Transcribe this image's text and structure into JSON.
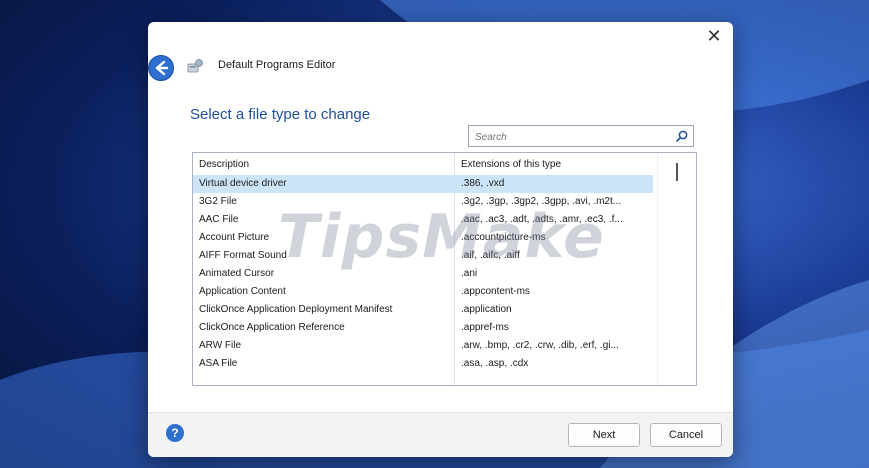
{
  "window": {
    "title": "Default Programs Editor",
    "close_glyph": "✕"
  },
  "heading": "Select a file type to change",
  "search": {
    "placeholder": "Search"
  },
  "list": {
    "columns": {
      "description": "Description",
      "extensions": "Extensions of this type"
    },
    "rows": [
      {
        "description": "Virtual device driver",
        "extensions": ".386, .vxd",
        "selected": true
      },
      {
        "description": "3G2 File",
        "extensions": ".3g2, .3gp, .3gp2, .3gpp, .avi, .m2t..."
      },
      {
        "description": "AAC File",
        "extensions": ".aac, .ac3, .adt, .adts, .amr, .ec3, .f..."
      },
      {
        "description": "Account Picture",
        "extensions": ".accountpicture-ms"
      },
      {
        "description": "AIFF Format Sound",
        "extensions": ".aif, .aifc, .aiff"
      },
      {
        "description": "Animated Cursor",
        "extensions": ".ani"
      },
      {
        "description": "Application Content",
        "extensions": ".appcontent-ms"
      },
      {
        "description": "ClickOnce Application Deployment Manifest",
        "extensions": ".application"
      },
      {
        "description": "ClickOnce Application Reference",
        "extensions": ".appref-ms"
      },
      {
        "description": "ARW File",
        "extensions": ".arw, .bmp, .cr2, .crw, .dib, .erf, .gi..."
      },
      {
        "description": "ASA File",
        "extensions": ".asa, .asp, .cdx"
      }
    ]
  },
  "footer": {
    "help_glyph": "?",
    "next_label": "Next",
    "cancel_label": "Cancel"
  },
  "watermark": "TipsMake",
  "icons": {
    "back": "back-arrow-icon",
    "app": "programs-icon",
    "search": "search-icon",
    "help": "help-icon",
    "close": "close-icon"
  },
  "colors": {
    "accent": "#1f4e9e",
    "selection": "#cce4f7",
    "button_blue": "#2f6fd0"
  }
}
